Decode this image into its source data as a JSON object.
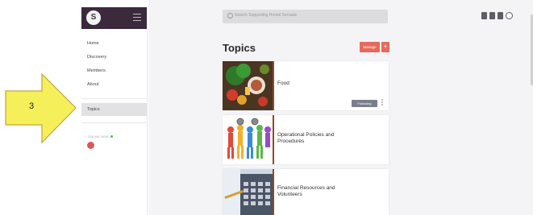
{
  "app": {
    "logo_letter": "S"
  },
  "sidebar": {
    "items": [
      {
        "label": "Home"
      },
      {
        "label": "Discovery"
      },
      {
        "label": "Members"
      },
      {
        "label": "About"
      }
    ],
    "active_item": {
      "label": "Topics"
    },
    "online_label": "ONLINE NOW"
  },
  "header": {
    "search_placeholder": "Search Supporting Homel Servade",
    "icons": [
      "document-icon",
      "copy-icon",
      "bell-icon",
      "user-avatar-icon"
    ]
  },
  "main": {
    "title": "Topics",
    "manage_label": "Manage",
    "add_label": "+",
    "topics": [
      {
        "title": "Food",
        "follow_label": "Following"
      },
      {
        "title": "Operational Policies and Procedures"
      },
      {
        "title": "Financial Resources and Volunteers"
      }
    ]
  },
  "annotation": {
    "step_number": "3",
    "color": "#f5f05a"
  },
  "colors": {
    "sidebar_header": "#3a2a3c",
    "accent_button": "#e56a5d",
    "follow_button": "#7a7f8a"
  }
}
